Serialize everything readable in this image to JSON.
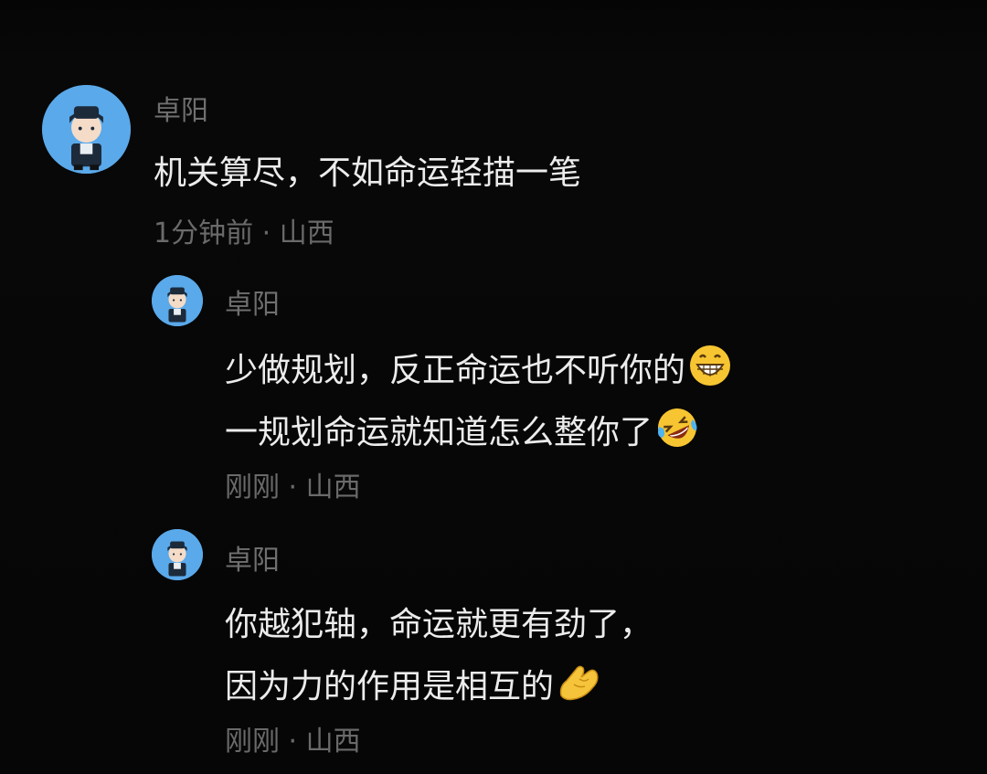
{
  "comments": [
    {
      "username": "卓阳",
      "lines": [
        "机关算尽，不如命运轻描一笔"
      ],
      "time": "1分钟前",
      "location": "山西"
    },
    {
      "username": "卓阳",
      "lines": [
        "少做规划，反正命运也不听你的",
        "一规划命运就知道怎么整你了"
      ],
      "emojis": [
        "grinning-face-emoji",
        "rolling-laughing-emoji"
      ],
      "time": "刚刚",
      "location": "山西"
    },
    {
      "username": "卓阳",
      "lines": [
        "你越犯轴，命运就更有劲了，",
        "因为力的作用是相互的"
      ],
      "emojis": [
        "ok-hand-emoji"
      ],
      "time": "刚刚",
      "location": "山西"
    }
  ],
  "meta_separator": " · ",
  "colors": {
    "background": "#000000",
    "avatar_bg": "#5aa9ea",
    "username": "#6f6f6f",
    "content": "#ececec",
    "meta": "#6a6a6a"
  }
}
